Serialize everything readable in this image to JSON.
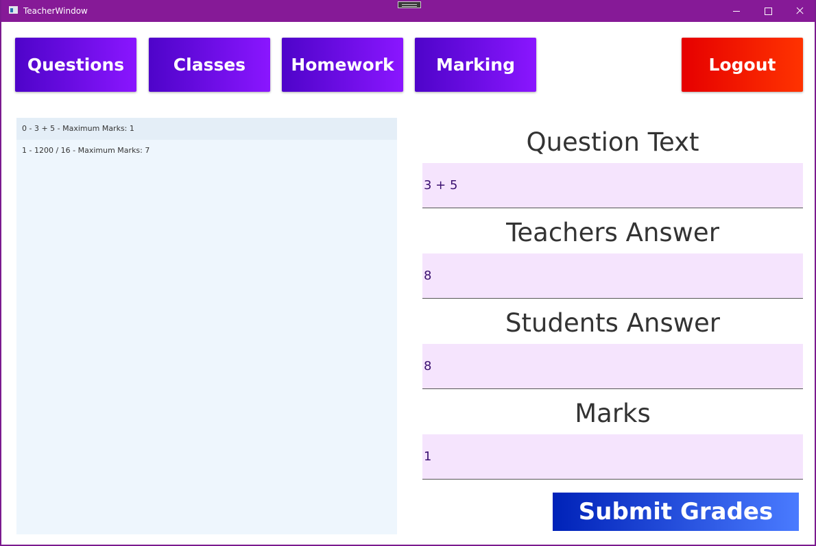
{
  "window": {
    "title": "TeacherWindow"
  },
  "nav": {
    "questions_label": "Questions",
    "classes_label": "Classes",
    "homework_label": "Homework",
    "marking_label": "Marking",
    "logout_label": "Logout"
  },
  "question_list": {
    "items": [
      {
        "label": "0 - 3 + 5 - Maximum Marks: 1",
        "selected": true
      },
      {
        "label": "1 - 1200 / 16 - Maximum Marks: 7",
        "selected": false
      }
    ]
  },
  "fields": {
    "question_text": {
      "label": "Question Text",
      "value": "3 + 5"
    },
    "teachers_answer": {
      "label": "Teachers Answer",
      "value": "8"
    },
    "students_answer": {
      "label": "Students Answer",
      "value": "8"
    },
    "marks": {
      "label": "Marks",
      "value": "1"
    }
  },
  "submit": {
    "label": "Submit Grades"
  },
  "colors": {
    "titlebar": "#861a97",
    "nav_gradient_start": "#4e04c9",
    "nav_gradient_end": "#8a16ff",
    "logout_gradient_start": "#e60000",
    "logout_gradient_end": "#ff3300",
    "submit_gradient_start": "#0022b8",
    "submit_gradient_end": "#4a7bff",
    "field_background": "#f5e4fd",
    "list_background": "#eef6fd"
  }
}
